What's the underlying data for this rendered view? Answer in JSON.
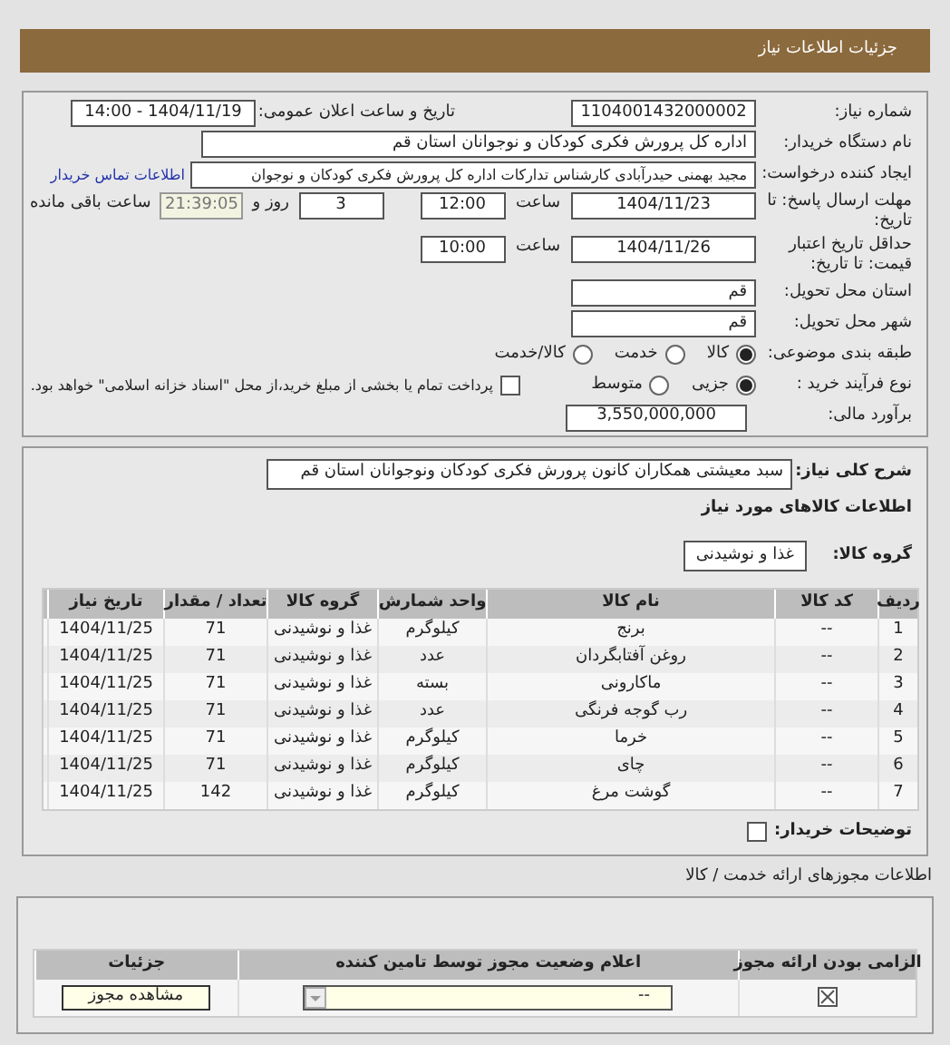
{
  "header": {
    "title": "جزئیات اطلاعات نیاز"
  },
  "need_number": {
    "label": "شماره نیاز:",
    "value": "1104001432000002"
  },
  "announce": {
    "label": "تاریخ و ساعت اعلان عمومی:",
    "value": "1404/11/19 - 14:00"
  },
  "buyer_org": {
    "label": "نام دستگاه خریدار:",
    "value": "اداره کل پرورش فکری کودکان و نوجوانان استان قم"
  },
  "requester": {
    "label": "ایجاد کننده درخواست:",
    "value": "مجید بهمنی حیدرآبادی کارشناس تدارکات اداره کل پرورش فکری کودکان و نوجوان",
    "link": "اطلاعات تماس خریدار"
  },
  "deadline": {
    "label": "مهلت ارسال پاسخ: تا تاریخ:",
    "date": "1404/11/23",
    "time_label": "ساعت",
    "time": "12:00",
    "days": "3",
    "days_label": "روز و",
    "remaining": "21:39:05",
    "remaining_label": "ساعت باقی مانده"
  },
  "validity": {
    "label": "حداقل تاریخ اعتبار قیمت: تا تاریخ:",
    "date": "1404/11/26",
    "time_label": "ساعت",
    "time": "10:00"
  },
  "province": {
    "label": "استان محل تحویل:",
    "value": "قم"
  },
  "city": {
    "label": "شهر محل تحویل:",
    "value": "قم"
  },
  "category": {
    "label": "طبقه بندی موضوعی:",
    "options": [
      {
        "label": "کالا",
        "selected": true
      },
      {
        "label": "خدمت",
        "selected": false
      },
      {
        "label": "کالا/خدمت",
        "selected": false
      }
    ]
  },
  "process": {
    "label": "نوع فرآیند خرید :",
    "options": [
      {
        "label": "جزیی",
        "selected": true
      },
      {
        "label": "متوسط",
        "selected": false
      }
    ],
    "payment": {
      "label": "پرداخت تمام یا بخشی از مبلغ خرید،از محل \"اسناد خزانه اسلامی\" خواهد بود.",
      "checked": false
    }
  },
  "estimate": {
    "label": "برآورد مالی:",
    "value": "3,550,000,000"
  },
  "description": {
    "label": "شرح کلی نیاز:",
    "value": "سبد معیشتی همکاران کانون پرورش فکری کودکان ونوجوانان استان قم"
  },
  "goods_title": "اطلاعات کالاهای مورد نیاز",
  "goods_group": {
    "label": "گروه کالا:",
    "value": "غذا و نوشیدنی"
  },
  "goods_table": {
    "columns": [
      "ردیف",
      "کد کالا",
      "نام کالا",
      "واحد شمارش",
      "گروه کالا",
      "تعداد / مقدار",
      "تاریخ نیاز"
    ],
    "rows": [
      [
        "1",
        "--",
        "برنج",
        "کیلوگرم",
        "غذا و نوشیدنی",
        "71",
        "1404/11/25"
      ],
      [
        "2",
        "--",
        "روغن آفتابگردان",
        "عدد",
        "غذا و نوشیدنی",
        "71",
        "1404/11/25"
      ],
      [
        "3",
        "--",
        "ماکارونی",
        "بسته",
        "غذا و نوشیدنی",
        "71",
        "1404/11/25"
      ],
      [
        "4",
        "--",
        "رب گوجه فرنگی",
        "عدد",
        "غذا و نوشیدنی",
        "71",
        "1404/11/25"
      ],
      [
        "5",
        "--",
        "خرما",
        "کیلوگرم",
        "غذا و نوشیدنی",
        "71",
        "1404/11/25"
      ],
      [
        "6",
        "--",
        "چای",
        "کیلوگرم",
        "غذا و نوشیدنی",
        "71",
        "1404/11/25"
      ],
      [
        "7",
        "--",
        "گوشت مرغ",
        "کیلوگرم",
        "غذا و نوشیدنی",
        "142",
        "1404/11/25"
      ]
    ]
  },
  "buyer_notes": {
    "label": "توضیحات خریدار:",
    "checked": false
  },
  "permits": {
    "title": "اطلاعات مجوزهای ارائه خدمت / کالا",
    "columns": [
      "الزامی بودن ارائه مجوز",
      "اعلام وضعیت مجوز توسط تامین کننده",
      "جزئیات"
    ],
    "rows": [
      {
        "required": true,
        "status": "--",
        "action": "مشاهده مجوز"
      }
    ]
  }
}
